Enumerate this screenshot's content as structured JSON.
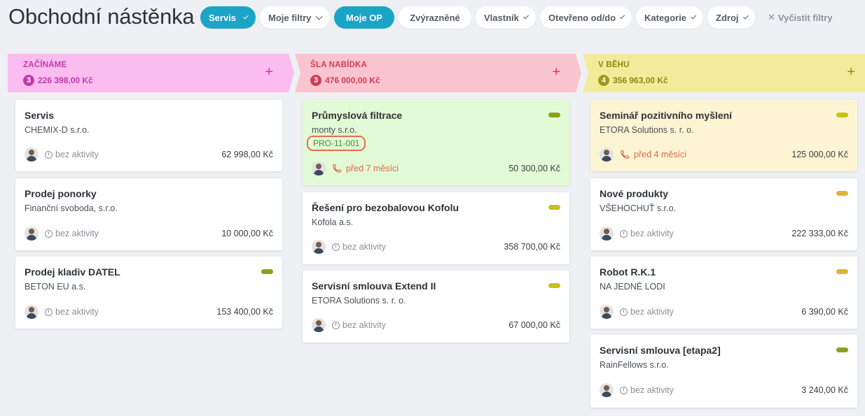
{
  "header": {
    "title": "Obchodní nástěnka",
    "filters": [
      {
        "label": "Servis",
        "active": true,
        "dropdown": true
      },
      {
        "label": "Moje filtry",
        "active": false,
        "dropdown": true
      },
      {
        "label": "Moje OP",
        "active": true,
        "dropdown": false
      },
      {
        "label": "Zvýrazněné",
        "active": false,
        "dropdown": false
      },
      {
        "label": "Vlastník",
        "active": false,
        "dropdown": true
      },
      {
        "label": "Otevřeno od/do",
        "active": false,
        "dropdown": true
      },
      {
        "label": "Kategorie",
        "active": false,
        "dropdown": true
      },
      {
        "label": "Zdroj",
        "active": false,
        "dropdown": true
      }
    ],
    "clear_label": "Vyčistit filtry"
  },
  "columns": [
    {
      "name": "ZAČÍNÁME",
      "count": "3",
      "total": "226 398,00 Kč",
      "color": "#fbbcef",
      "cards": [
        {
          "title": "Servis",
          "company": "CHEMIX-D s.r.o.",
          "activity": "bez aktivity",
          "amount": "62 998,00 Kč"
        },
        {
          "title": "Prodej ponorky",
          "company": "Finanční svoboda, s.r.o.",
          "activity": "bez aktivity",
          "amount": "10 000,00 Kč"
        },
        {
          "title": "Prodej kladiv DATEL",
          "company": "BETON EU a.s.",
          "activity": "bez aktivity",
          "amount": "153 400,00 Kč",
          "tag_color": "#8aa31a"
        }
      ]
    },
    {
      "name": "ŠLA NABÍDKA",
      "count": "3",
      "total": "476 000,00 Kč",
      "color": "#fbc5cf",
      "cards": [
        {
          "title": "Průmyslová filtrace",
          "company": "monty s.r.o.",
          "code": "PRO-11-001",
          "activity": "před 7 měsíci",
          "amount": "50 300,00 Kč",
          "tag_color": "#8aa31a"
        },
        {
          "title": "Řešení pro bezobalovou Kofolu",
          "company": "Kofola a.s.",
          "activity": "bez aktivity",
          "amount": "358 700,00 Kč",
          "tag_color": "#c8c21a"
        },
        {
          "title": "Servisní smlouva Extend II",
          "company": "ETORA Solutions s. r. o.",
          "activity": "bez aktivity",
          "amount": "67 000,00 Kč",
          "tag_color": "#c8c21a"
        }
      ]
    },
    {
      "name": "V BĚHU",
      "count": "4",
      "total": "356 963,00 Kč",
      "color": "#f3eb9c",
      "cards": [
        {
          "title": "Seminář pozitivního myšlení",
          "company": "ETORA Solutions s. r. o.",
          "activity": "před 4 měsíci",
          "amount": "125 000,00 Kč",
          "tag_color": "#c8c21a"
        },
        {
          "title": "Nové produkty",
          "company": "VŠEHOCHUŤ s.r.o.",
          "activity": "bez aktivity",
          "amount": "222 333,00 Kč",
          "tag_color": "#e0b43c"
        },
        {
          "title": "Robot R.K.1",
          "company": "NA JEDNÉ LODI",
          "activity": "bez aktivity",
          "amount": "6 390,00 Kč",
          "tag_color": "#e0b43c"
        },
        {
          "title": "Servisní smlouva [etapa2]",
          "company": "RainFellows s.r.o.",
          "activity": "bez aktivity",
          "amount": "3 240,00 Kč",
          "tag_color": "#8aa31a"
        }
      ]
    }
  ]
}
